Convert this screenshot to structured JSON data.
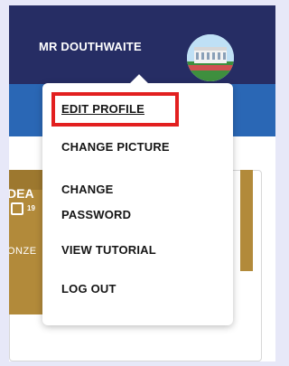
{
  "header": {
    "user_name": "MR DOUTHWAITE",
    "avatar_icon": "avatar-image"
  },
  "menu": {
    "items": [
      {
        "label": "EDIT PROFILE"
      },
      {
        "label": "CHANGE PICTURE"
      },
      {
        "label": "CHANGE PASSWORD"
      },
      {
        "label": "VIEW TUTORIAL"
      },
      {
        "label": "LOG OUT"
      }
    ]
  },
  "badge": {
    "line1": "DEA",
    "line2": "19",
    "line3": "ONZE"
  },
  "colors": {
    "top_bar": "#262d64",
    "sub_bar": "#2a67b5",
    "badge_gold": "#b28a3a",
    "highlight": "#e21f1f",
    "page_bg": "#e7e8f8"
  }
}
